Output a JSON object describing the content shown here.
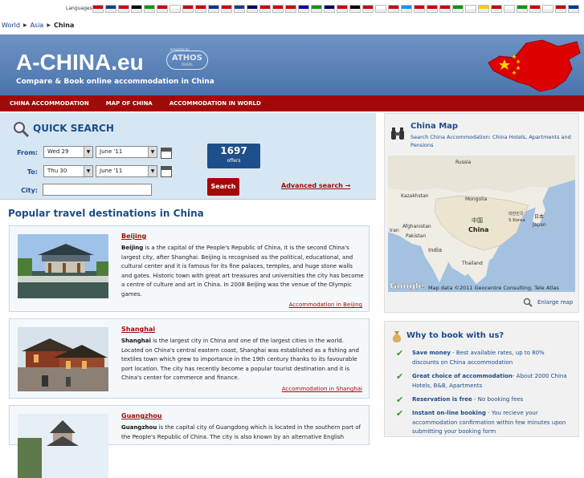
{
  "langbar": {
    "label": "Languages:",
    "flag_colors": [
      "#c00",
      "#1a3c8c",
      "#c00",
      "#000",
      "#090",
      "#c00",
      "#fff",
      "#c00",
      "#c00",
      "#039",
      "#c00",
      "#1a3c8c",
      "#006",
      "#c00",
      "#c00",
      "#c00",
      "#00a",
      "#090",
      "#006",
      "#c00",
      "#000",
      "#c00",
      "#fff",
      "#c00",
      "#09f",
      "#c00",
      "#c00",
      "#c00",
      "#090",
      "#fff",
      "#fc0",
      "#c00",
      "#fff",
      "#090",
      "#c00",
      "#fff",
      "#c00",
      "#039"
    ]
  },
  "breadcrumb": [
    "World",
    "Asia",
    "China"
  ],
  "header": {
    "logo": "A-CHINA",
    "logo_suffix": ".eu",
    "athos": "ATHOS",
    "athos_small": "provided by",
    "athos_sub": "TRAVEL",
    "tagline": "Compare & Book online accommodation in China"
  },
  "nav": [
    "CHINA ACCOMMODATION",
    "MAP OF CHINA",
    "ACCOMMODATION IN WORLD"
  ],
  "search": {
    "title": "QUICK SEARCH",
    "from_label": "From:",
    "to_label": "To:",
    "city_label": "City:",
    "from_day": "Wed 29",
    "from_month": "June '11",
    "to_day": "Thu 30",
    "to_month": "June '11",
    "city_value": "",
    "offers_count": "1697",
    "offers_label": "offers",
    "search_button": "Search",
    "advanced": "Advanced search →"
  },
  "popular_title": "Popular travel destinations in China",
  "destinations": [
    {
      "name": "Beijing",
      "bold": "Beijing",
      "text": " is a the capital of the People's Republic of China, it is the second China's largest city, after Shanghai. Beijing is recognised as the political, educational, and cultural center and it is famous for its fine palaces, temples, and huge stone walls and gates. Historic town with great art treasures and universities the city has become a centre of culture and art in China. In 2008 Beijing was the venue of the Olympic games.",
      "link": "Accommodation in Beijing"
    },
    {
      "name": "Shanghai",
      "bold": "Shanghai",
      "text": " is the largest city in China and one of the largest cities in the world. Located on China's central eastern coast, Shanghai was established as a fishing and textiles town which grew to importance in the 19th century thanks to its favourable port location. The city has recently become a popular tourist destination and it is China's center for commerce and finance.",
      "link": "Accommodation in Shanghai"
    },
    {
      "name": "Guangzhou",
      "bold": "Guangzhou",
      "text": " is the capital city of Guangdong which is located in the southern part of the People's Republic of China. The city is also known by an alternative English",
      "link": ""
    }
  ],
  "map": {
    "title": "China Map",
    "subtitle": "Search China Accommodation: China Hotels, Apartments and Pensions",
    "labels": [
      "Russia",
      "Kazakhstan",
      "Mongolia",
      "中国",
      "China",
      "대한민국",
      "S Korea",
      "日本",
      "Japan",
      "Iran",
      "Afghanistan",
      "Pakistan",
      "India",
      "Thailand"
    ],
    "google": "Google",
    "copyright": "Map data ©2011 Geocentre Consulting, Tele Atlas",
    "enlarge": "Enlarge map"
  },
  "why": {
    "title": "Why to book with us?",
    "reasons": [
      {
        "bold": "Save money",
        "text": " - Best available rates, up to 80% discounts on China accommodation"
      },
      {
        "bold": "Great choice of accommodation",
        "text": "- About 2000 China Hotels, B&B, Apartments"
      },
      {
        "bold": "Reservation is free",
        "text": " - No booking fees"
      },
      {
        "bold": "Instant on-line booking",
        "text": " - You recieve your accommodation confirmation within few minutes upon submitting your booking form"
      }
    ]
  }
}
